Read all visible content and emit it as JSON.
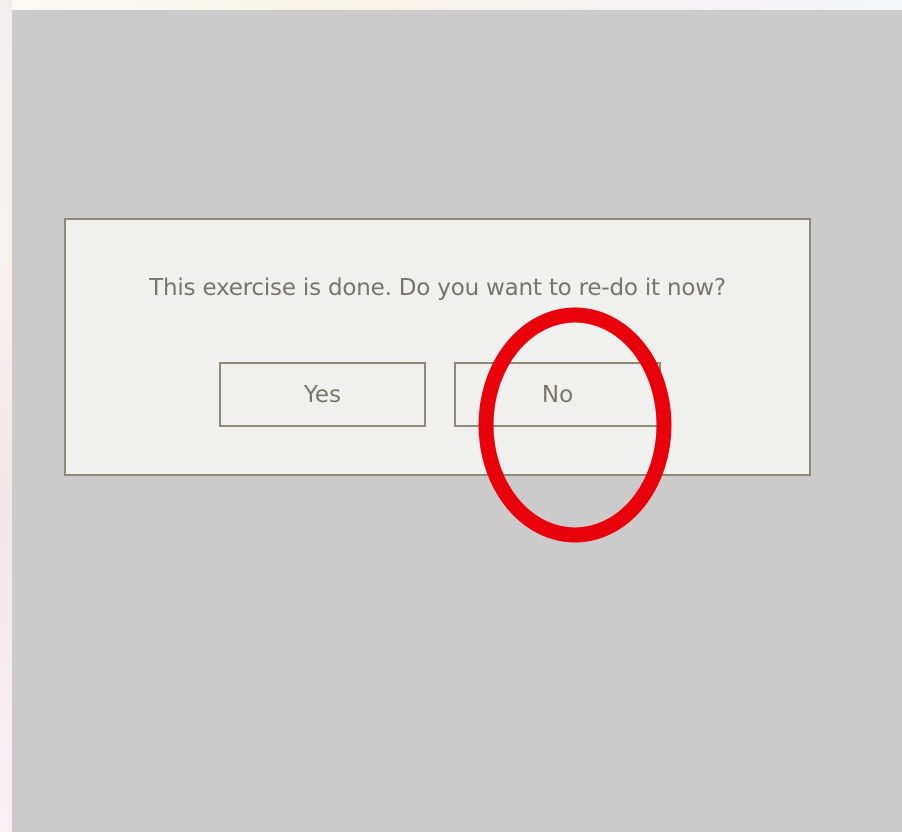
{
  "dialog": {
    "message": "This exercise is done. Do you want to re-do it now?",
    "yes_label": "Yes",
    "no_label": "No"
  },
  "colors": {
    "overlay": "#cbcbcb",
    "dialog_background": "#f0f0ee",
    "dialog_border": "#8d8a78",
    "text": "#77766d",
    "annotation": "#e8000b"
  },
  "annotation": {
    "shape": "circle-highlight",
    "target": "no-button"
  }
}
